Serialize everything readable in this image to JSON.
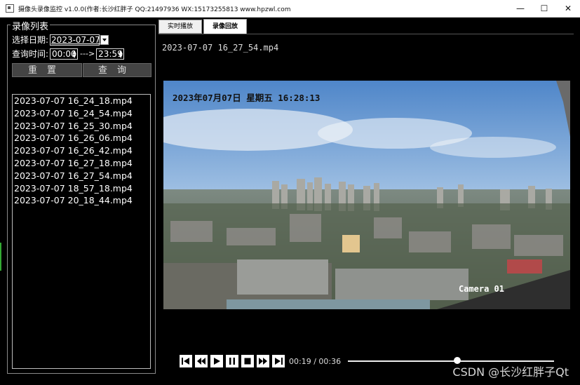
{
  "window": {
    "title": "摄像头录像监控 v1.0.0(作者:长沙红胖子 QQ:21497936 WX:15173255813 www.hpzwl.com",
    "min_glyph": "—",
    "max_glyph": "☐",
    "close_glyph": "✕"
  },
  "left_panel": {
    "title": "录像列表",
    "date_label": "选择日期:",
    "date_value": "2023-07-07",
    "time_label": "查询时间:",
    "time_from": "00:00",
    "time_sep": "--->",
    "time_to": "23:59",
    "reset_label": "重置",
    "query_label": "查询",
    "files": [
      "2023-07-07 16_24_18.mp4",
      "2023-07-07 16_24_54.mp4",
      "2023-07-07 16_25_30.mp4",
      "2023-07-07 16_26_06.mp4",
      "2023-07-07 16_26_42.mp4",
      "2023-07-07 16_27_18.mp4",
      "2023-07-07 16_27_54.mp4",
      "2023-07-07 18_57_18.mp4",
      "2023-07-07 20_18_44.mp4"
    ]
  },
  "tabs": [
    {
      "label": "实时播放",
      "active": false
    },
    {
      "label": "录像回放",
      "active": true
    }
  ],
  "player": {
    "current_file": "2023-07-07 16_27_54.mp4",
    "osd_datetime": "2023年07月07日 星期五 16:28:13",
    "osd_camera": "Camera 01",
    "time_current": "00:19",
    "time_total": "00:36",
    "time_sep": "/",
    "progress_fraction": 0.53
  },
  "icons": [
    "skip-start-icon",
    "rewind-icon",
    "play-icon",
    "pause-icon",
    "stop-icon",
    "fast-forward-icon",
    "skip-end-icon"
  ],
  "watermark": "CSDN @长沙红胖子Qt"
}
